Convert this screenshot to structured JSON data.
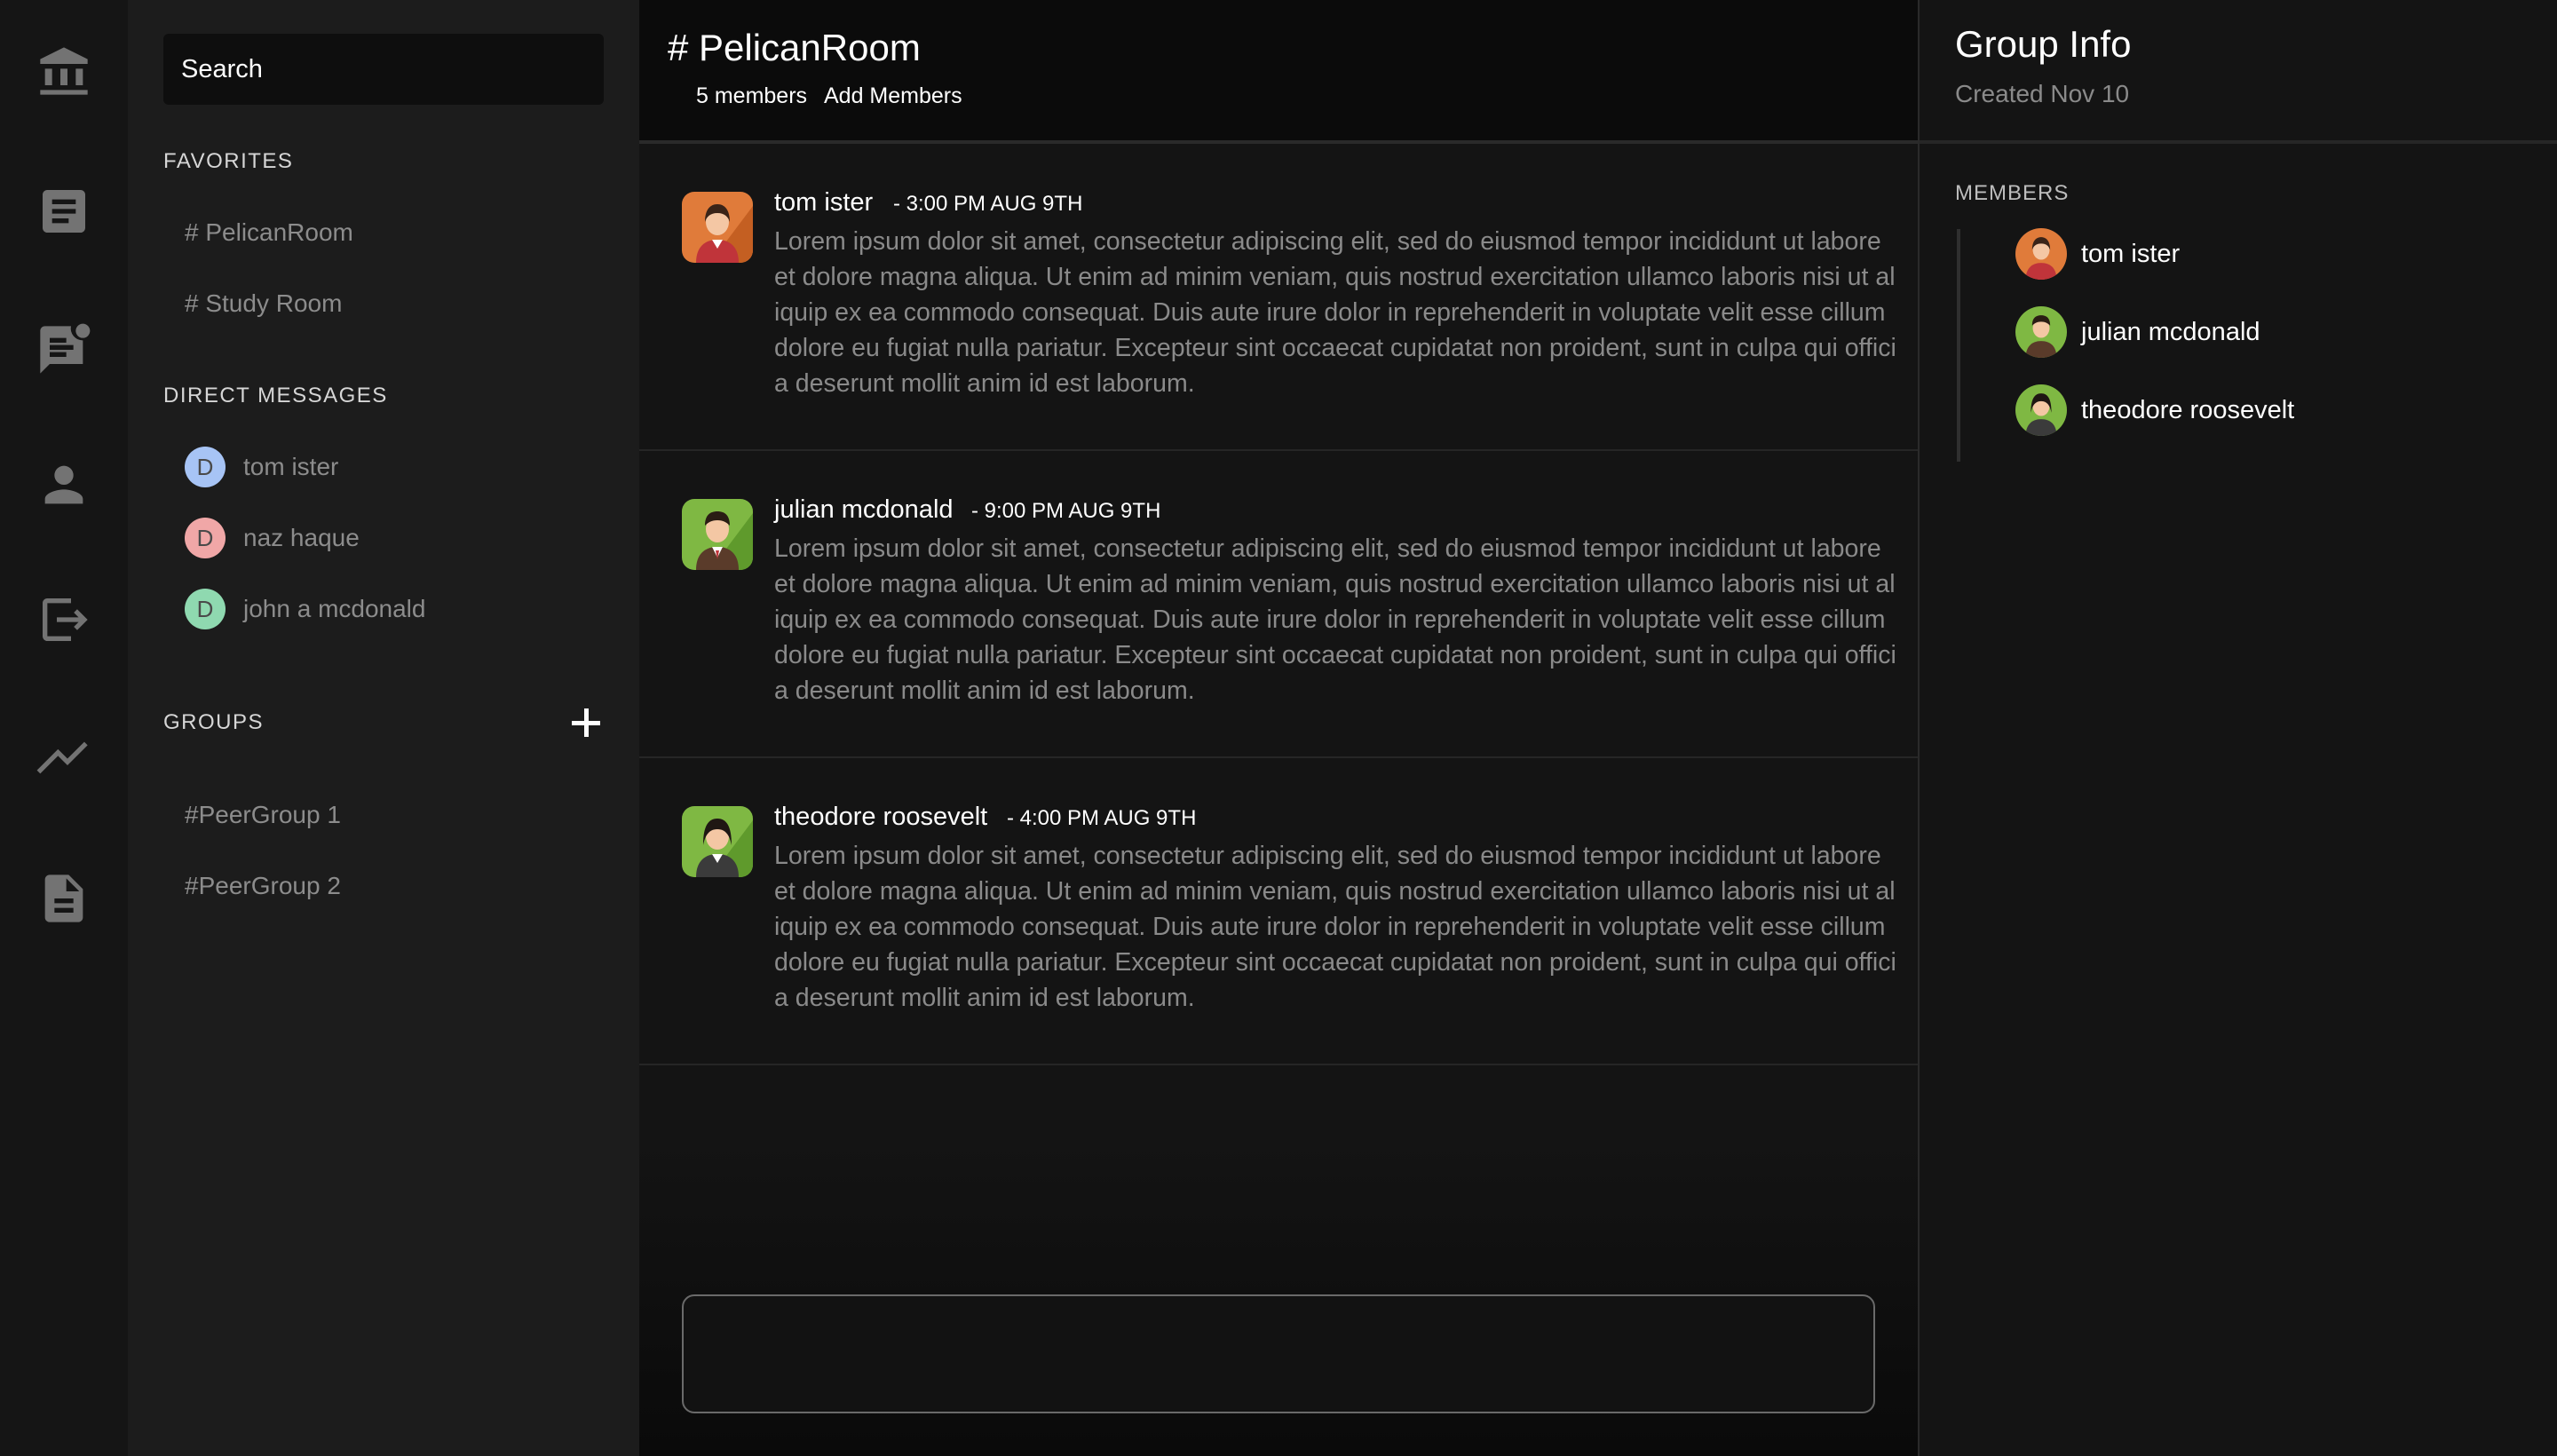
{
  "nav_rail": {
    "icons": [
      "bank-icon",
      "document-icon",
      "chat-icon",
      "person-icon",
      "logout-icon",
      "trending-icon",
      "file-icon"
    ]
  },
  "sidebar": {
    "search_label": "Search",
    "favorites_label": "FAVORITES",
    "favorites": [
      "# PelicanRoom",
      "# Study Room"
    ],
    "direct_messages_label": "DIRECT MESSAGES",
    "direct_messages": [
      {
        "initial": "D",
        "name": "tom ister",
        "color": "#a7c4f5"
      },
      {
        "initial": "D",
        "name": "naz haque",
        "color": "#f0a7a7"
      },
      {
        "initial": "D",
        "name": "john a mcdonald",
        "color": "#8fd9b0"
      }
    ],
    "groups_label": "GROUPS",
    "groups": [
      "#PeerGroup 1",
      "#PeerGroup 2"
    ]
  },
  "room": {
    "title": "# PelicanRoom",
    "member_count": "5 members",
    "add_members_label": "Add Members"
  },
  "messages": [
    {
      "author": "tom ister",
      "time": "- 3:00 PM AUG 9TH",
      "avatar_bg": "#e07b3a",
      "body": "Lorem ipsum dolor sit amet, consectetur adipiscing elit, sed do eiusmod tempor incididunt ut labore et dolore magna aliqua. Ut enim ad minim veniam, quis nostrud exercitation ullamco laboris nisi ut aliquip ex ea commodo consequat. Duis aute irure dolor in reprehenderit in voluptate velit esse cillum dolore eu fugiat nulla pariatur. Excepteur sint occaecat cupidatat non proident, sunt in culpa qui officia deserunt mollit anim id est laborum."
    },
    {
      "author": "julian mcdonald",
      "time": "- 9:00 PM AUG 9TH",
      "avatar_bg": "#7fb843",
      "body": "Lorem ipsum dolor sit amet, consectetur adipiscing elit, sed do eiusmod tempor incididunt ut labore et dolore magna aliqua. Ut enim ad minim veniam, quis nostrud exercitation ullamco laboris nisi ut aliquip ex ea commodo consequat. Duis aute irure dolor in reprehenderit in voluptate velit esse cillum dolore eu fugiat nulla pariatur. Excepteur sint occaecat cupidatat non proident, sunt in culpa qui officia deserunt mollit anim id est laborum."
    },
    {
      "author": "theodore roosevelt",
      "time": "- 4:00 PM AUG 9TH",
      "avatar_bg": "#7fb843",
      "body": "Lorem ipsum dolor sit amet, consectetur adipiscing elit, sed do eiusmod tempor incididunt ut labore et dolore magna aliqua. Ut enim ad minim veniam, quis nostrud exercitation ullamco laboris nisi ut aliquip ex ea commodo consequat. Duis aute irure dolor in reprehenderit in voluptate velit esse cillum dolore eu fugiat nulla pariatur. Excepteur sint occaecat cupidatat non proident, sunt in culpa qui officia deserunt mollit anim id est laborum."
    }
  ],
  "composer": {
    "value": ""
  },
  "group_info": {
    "title": "Group Info",
    "created": "Created Nov 10",
    "members_label": "MEMBERS",
    "members": [
      {
        "name": "tom ister",
        "avatar_bg": "#e07b3a"
      },
      {
        "name": "julian mcdonald",
        "avatar_bg": "#7fb843"
      },
      {
        "name": "theodore roosevelt",
        "avatar_bg": "#7fb843"
      }
    ]
  },
  "colors": {
    "rail_bg": "#151515",
    "sidebar_bg": "#1c1c1c",
    "main_bg": "#141414",
    "muted_text": "#8c8c8c"
  }
}
